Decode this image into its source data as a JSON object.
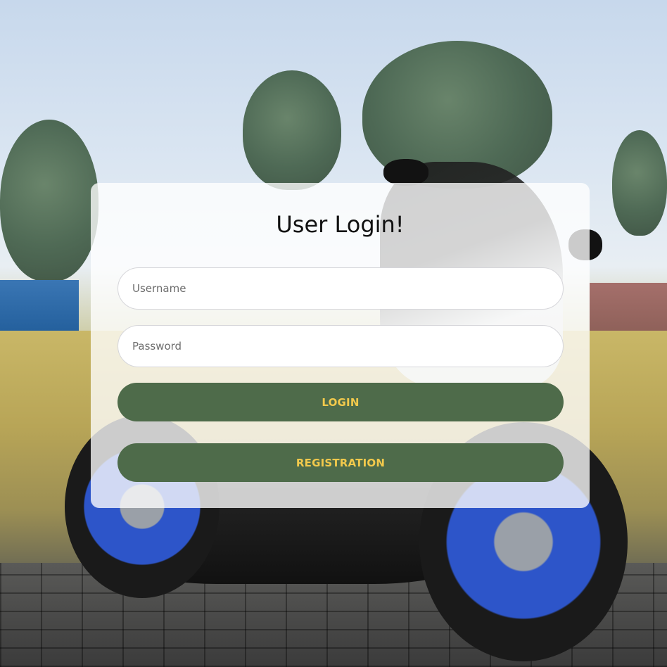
{
  "login_card": {
    "title": "User Login!",
    "username_placeholder": "Username",
    "password_placeholder": "Password",
    "login_label": "LOGIN",
    "registration_label": "REGISTRATION"
  },
  "colors": {
    "button_background": "#4e6b4a",
    "button_text": "#f2c94c",
    "card_background": "rgba(255,255,255,0.78)"
  }
}
